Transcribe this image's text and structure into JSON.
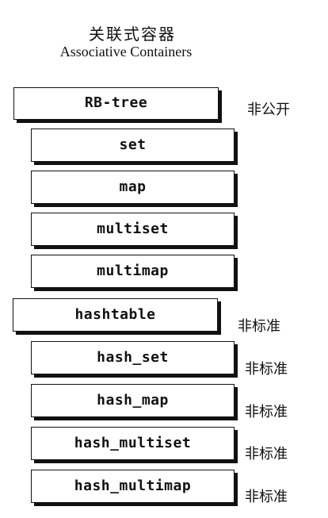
{
  "header": {
    "title_zh": "关联式容器",
    "title_en": "Associative Containers"
  },
  "containers": [
    {
      "label": "RB-tree",
      "note": "非公开"
    },
    {
      "label": "set",
      "note": ""
    },
    {
      "label": "map",
      "note": ""
    },
    {
      "label": "multiset",
      "note": ""
    },
    {
      "label": "multimap",
      "note": ""
    },
    {
      "label": "hashtable",
      "note": "非标准"
    },
    {
      "label": "hash_set",
      "note": "非标准"
    },
    {
      "label": "hash_map",
      "note": "非标准"
    },
    {
      "label": "hash_multiset",
      "note": "非标准"
    },
    {
      "label": "hash_multimap",
      "note": "非标准"
    }
  ]
}
